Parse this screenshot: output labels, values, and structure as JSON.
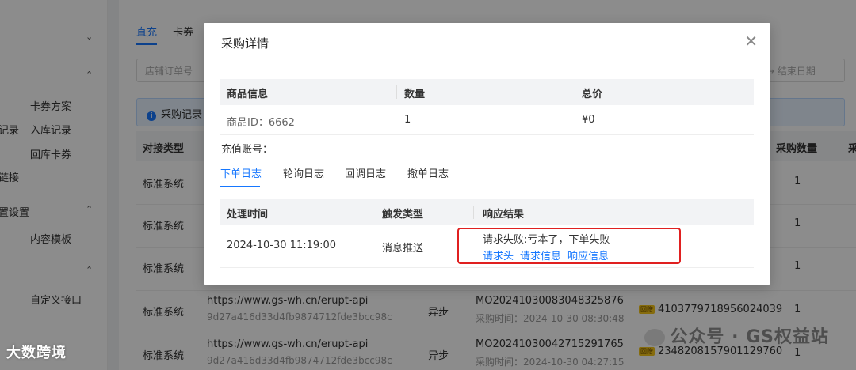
{
  "sidebar": {
    "items": [
      {
        "label": "卡券方案"
      },
      {
        "label": "记录"
      },
      {
        "label": "入库记录"
      },
      {
        "label": "回库卡券"
      },
      {
        "label": "链接"
      },
      {
        "label": "置设置"
      },
      {
        "label": "内容模板"
      },
      {
        "label": "自定义接口"
      }
    ]
  },
  "main": {
    "tabs": [
      {
        "label": "直充"
      },
      {
        "label": "卡券"
      }
    ],
    "filter_placeholder": "店铺订单号",
    "end_date_placeholder": "→  结束日期",
    "info_text": "采购记录",
    "table": {
      "headers": {
        "type": "对接类型",
        "qty": "采购数量",
        "more": "采"
      },
      "rows": [
        {
          "type": "标准系统",
          "qty": "1",
          "url": "",
          "hash": "",
          "mode": "",
          "order_no": "",
          "order_time": "",
          "coupon": ""
        },
        {
          "type": "标准系统",
          "qty": "1",
          "url": "",
          "hash": "",
          "mode": "",
          "order_no": "",
          "order_time": "",
          "coupon": ""
        },
        {
          "type": "标准系统",
          "qty": "1",
          "url": "",
          "hash": "",
          "mode": "",
          "order_no": "",
          "order_time": "",
          "coupon": ""
        },
        {
          "type": "标准系统",
          "qty": "1",
          "url": "https://www.gs-wh.cn/erupt-api",
          "hash": "9d27a416d33d4fb9874712fde3bcc98c",
          "mode": "异步",
          "order_no": "MO20241030083048325876",
          "order_time": "采购时间：2024-10-30 08:30:48",
          "coupon": "4103779718956024039"
        },
        {
          "type": "标准系统",
          "qty": "1",
          "url": "https://www.gs-wh.cn/erupt-api",
          "hash": "9d27a416d33d4fb9874712fde3bcc98c",
          "mode": "异步",
          "order_no": "MO20241030042715291765",
          "order_time": "采购时间：2024-10-30 04:27:15",
          "coupon": "2348208157901129760"
        }
      ]
    }
  },
  "watermark": {
    "left": "大数跨境",
    "right": "公众号 · GS权益站"
  },
  "modal": {
    "title": "采购详情",
    "close_icon": "close-icon",
    "product_table": {
      "headers": {
        "info": "商品信息",
        "qty": "数量",
        "total": "总价"
      },
      "row": {
        "info": "商品ID：6662",
        "qty": "1",
        "total": "¥0"
      }
    },
    "recharge_label": "充值账号：",
    "tabs": [
      {
        "label": "下单日志",
        "active": true
      },
      {
        "label": "轮询日志",
        "active": false
      },
      {
        "label": "回调日志",
        "active": false
      },
      {
        "label": "撤单日志",
        "active": false
      }
    ],
    "log_table": {
      "headers": {
        "time": "处理时间",
        "trigger": "触发类型",
        "result": "响应结果"
      },
      "row": {
        "time": "2024-10-30 11:19:00",
        "trigger": "消息推送",
        "result": "请求失败:亏本了，下单失败",
        "links": {
          "req_header": "请求头",
          "req_info": "请求信息",
          "resp_info": "响应信息"
        }
      }
    }
  },
  "colors": {
    "accent": "#1677ff",
    "highlight": "#e02020"
  }
}
